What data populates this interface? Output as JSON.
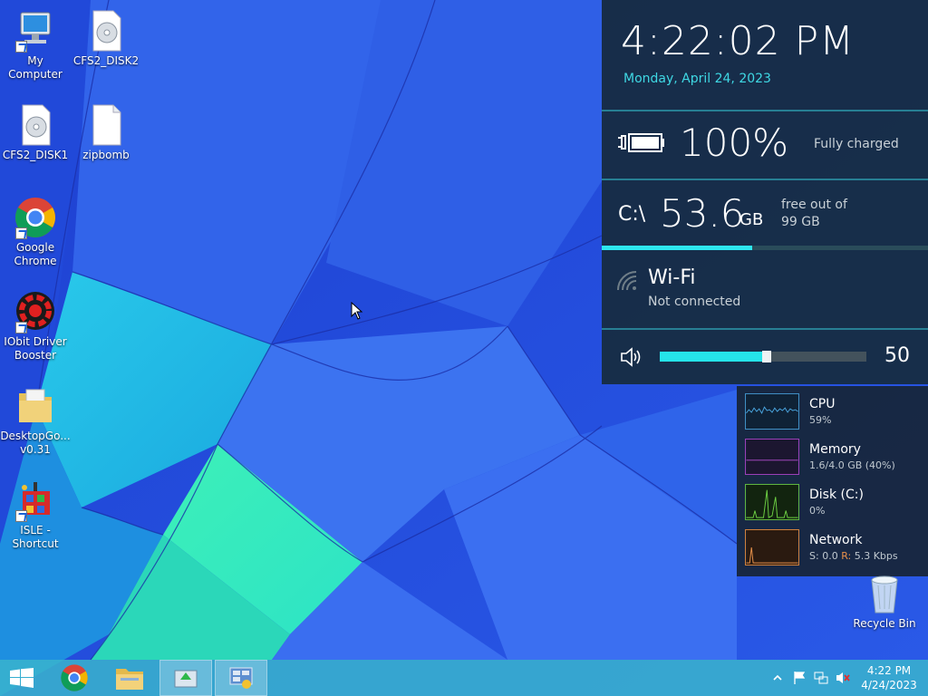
{
  "desktop": {
    "icons": [
      {
        "label": "My Computer"
      },
      {
        "label": "CFS2_DISK2"
      },
      {
        "label": "CFS2_DISK1"
      },
      {
        "label": "zipbomb"
      },
      {
        "label_line1": "Google",
        "label_line2": "Chrome"
      },
      {
        "label_line1": "IObit Driver",
        "label_line2": "Booster"
      },
      {
        "label_line1": "DesktopGo...",
        "label_line2": "v0.31"
      },
      {
        "label_line1": "ISLE -",
        "label_line2": "Shortcut"
      }
    ],
    "recycle_bin": {
      "label": "Recycle Bin"
    }
  },
  "flyout": {
    "time": "4:22:02 PM",
    "date": "Monday, April 24, 2023",
    "battery": {
      "percent_text": "100%",
      "status": "Fully charged"
    },
    "disk": {
      "drive": "C:\\",
      "free_value": "53.6",
      "unit": "GB",
      "free_line1": "free out of",
      "free_line2": "99 GB",
      "used_fraction": 0.46
    },
    "wifi": {
      "name": "Wi-Fi",
      "status": "Not connected"
    },
    "volume": {
      "value_text": "50",
      "level": 0.5
    }
  },
  "resource_monitor": {
    "cpu": {
      "label": "CPU",
      "value": "59%",
      "color": "#3f8fc4"
    },
    "memory": {
      "label": "Memory",
      "value": "1.6/4.0 GB (40%)",
      "color": "#9b3fb7"
    },
    "disk": {
      "label": "Disk (C:)",
      "value": "0%",
      "color": "#5fb63f"
    },
    "network": {
      "label": "Network",
      "s_label": "S:",
      "s_value": "0.0",
      "r_label": "R:",
      "r_value": "5.3 Kbps",
      "color": "#d0803b"
    }
  },
  "taskbar": {
    "clock_time": "4:22 PM",
    "clock_date": "4/24/2023",
    "accent": "#3ab4cd"
  }
}
